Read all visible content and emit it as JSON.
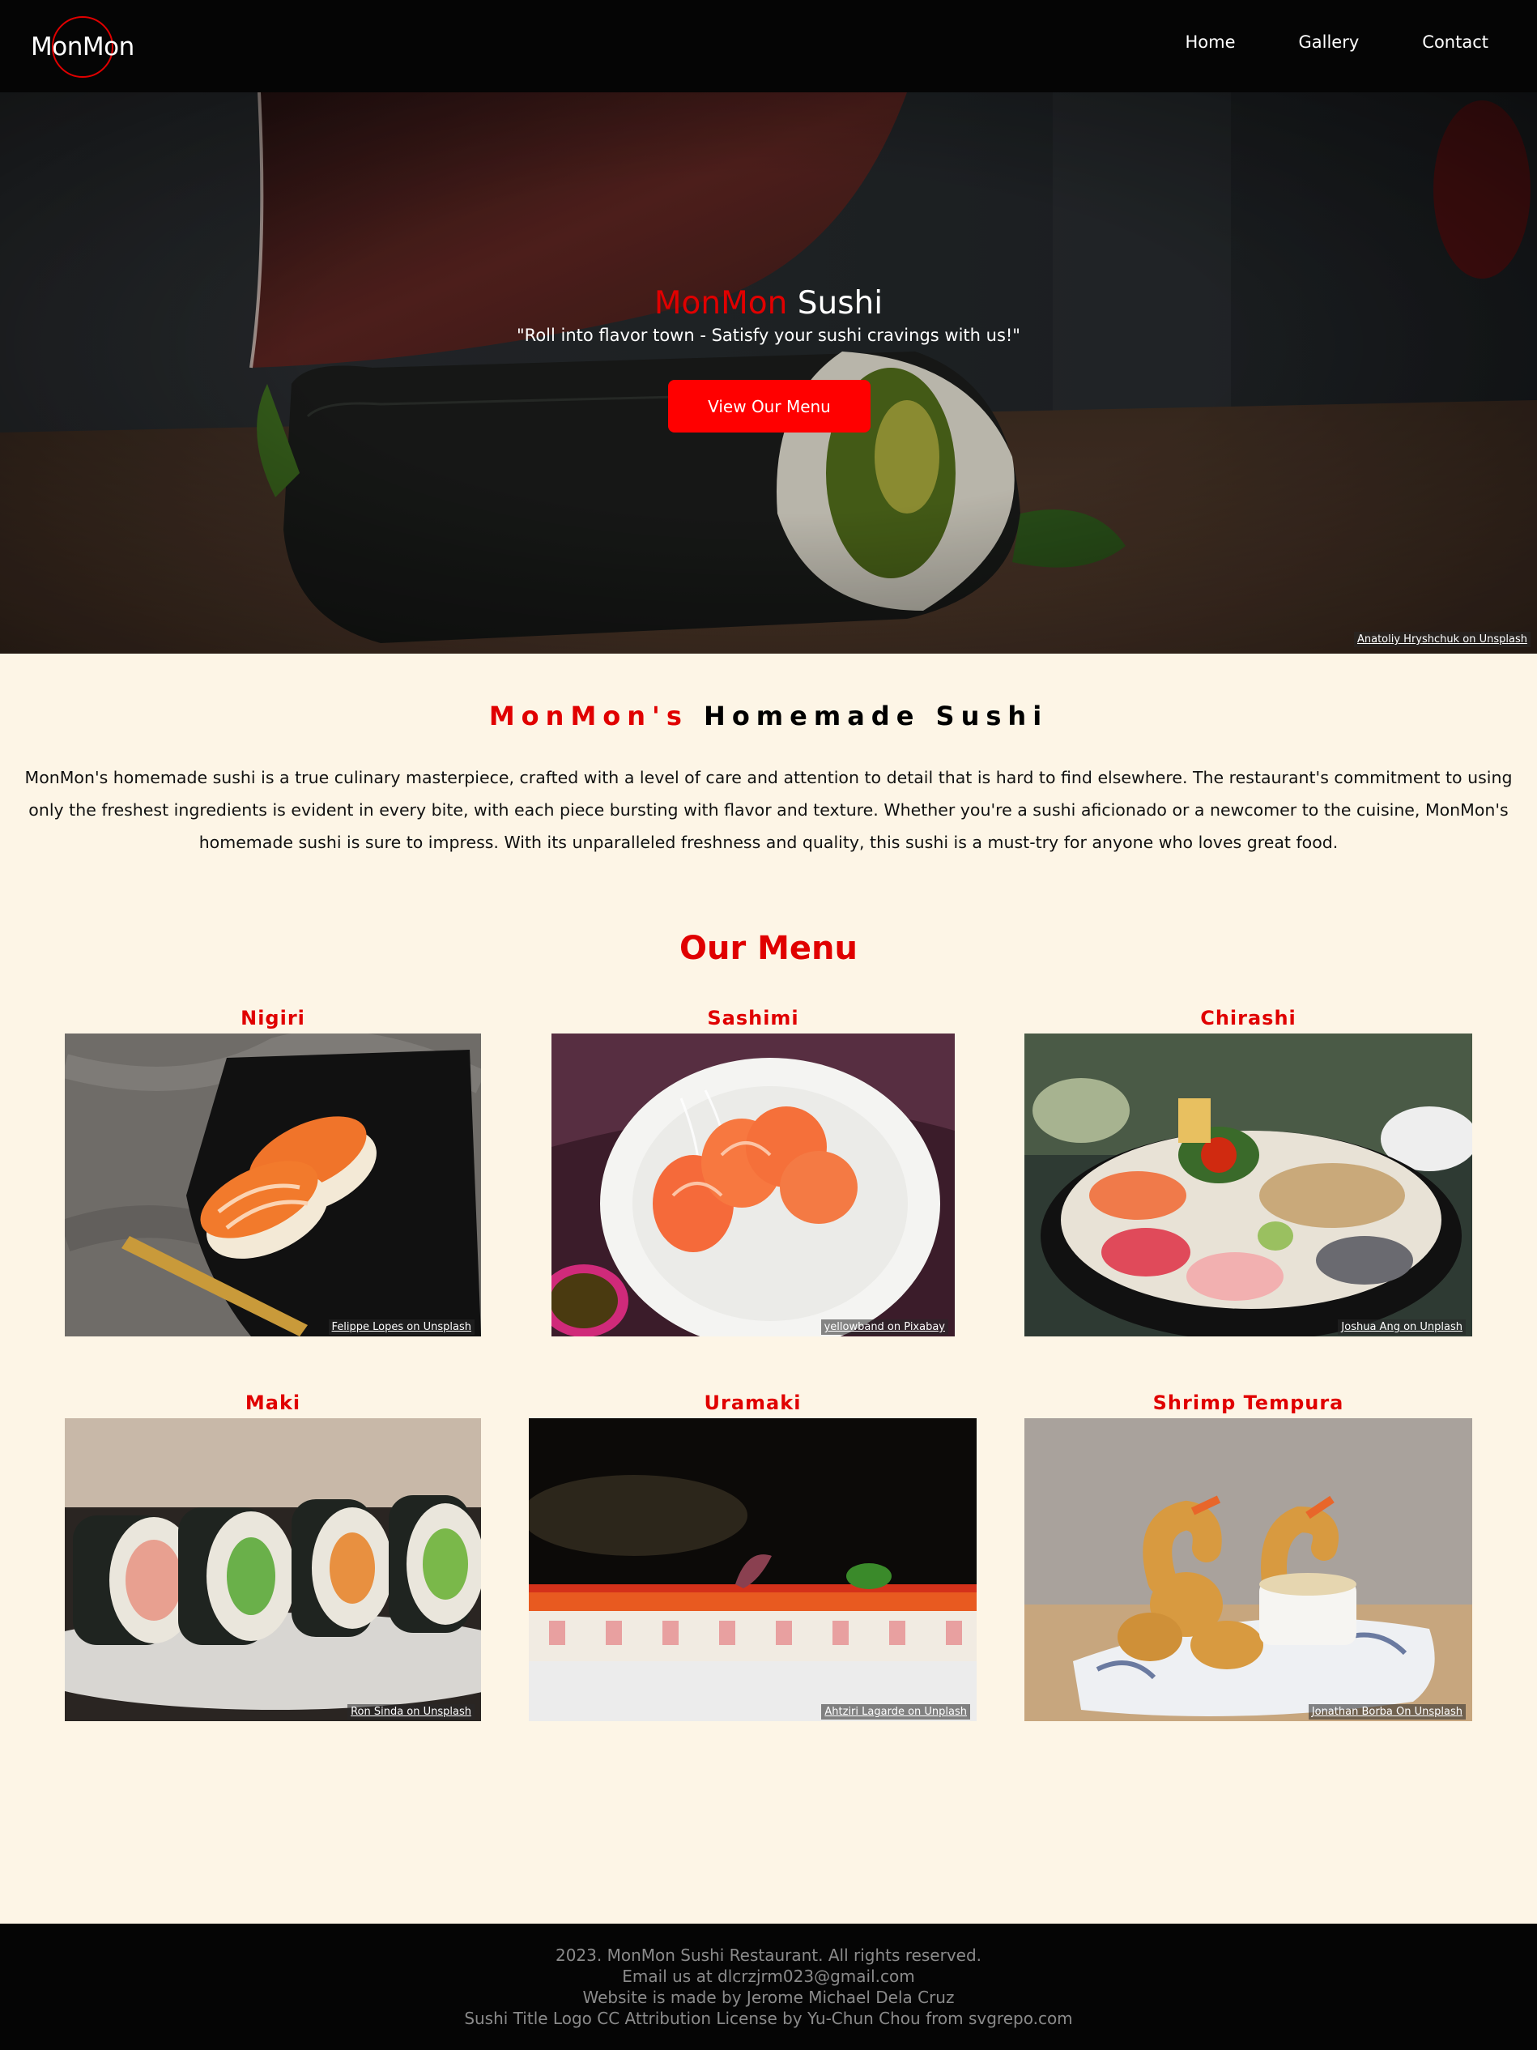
{
  "navbar": {
    "logo_text": "MonMon",
    "links": [
      "Home",
      "Gallery",
      "Contact"
    ]
  },
  "hero": {
    "title_accent": "MonMon",
    "title_rest": "Sushi",
    "tagline": "\"Roll into flavor town - Satisfy your sushi cravings with us!\"",
    "button_label": "View Our Menu",
    "photo_credit": "Anatoliy Hryshchuk on Unsplash"
  },
  "about": {
    "title_accent": "MonMon's",
    "title_rest": "Homemade Sushi",
    "text": "MonMon's homemade sushi is a true culinary masterpiece, crafted with a level of care and attention to detail that is hard to find elsewhere. The restaurant's commitment to using only the freshest ingredients is evident in every bite, with each piece bursting with flavor and texture. Whether you're a sushi aficionado or a newcomer to the cuisine, MonMon's homemade sushi is sure to impress. With its unparalleled freshness and quality, this sushi is a must-try for anyone who loves great food."
  },
  "menu": {
    "title": "Our Menu",
    "items": [
      {
        "name": "Nigiri",
        "credit": "Felippe Lopes on Unsplash"
      },
      {
        "name": "Sashimi",
        "credit": "yellowband on Pixabay"
      },
      {
        "name": "Chirashi",
        "credit": "Joshua Ang on Unplash"
      },
      {
        "name": "Maki",
        "credit": "Ron Sinda on Unsplash"
      },
      {
        "name": "Uramaki",
        "credit": "Ahtziri Lagarde on Unplash"
      },
      {
        "name": "Shrimp Tempura",
        "credit": "Jonathan Borba On Unsplash"
      }
    ]
  },
  "footer": {
    "lines": [
      "2023. MonMon Sushi Restaurant. All rights reserved.",
      "Email us at dlcrzjrm023@gmail.com",
      "Website is made by Jerome Michael Dela Cruz",
      "Sushi Title Logo CC Attribution License by Yu-Chun Chou from svgrepo.com"
    ]
  },
  "colors": {
    "accent": "#e00000",
    "button": "#ff0000",
    "page_bg": "#fdf5e6",
    "nav_bg": "#050505"
  }
}
